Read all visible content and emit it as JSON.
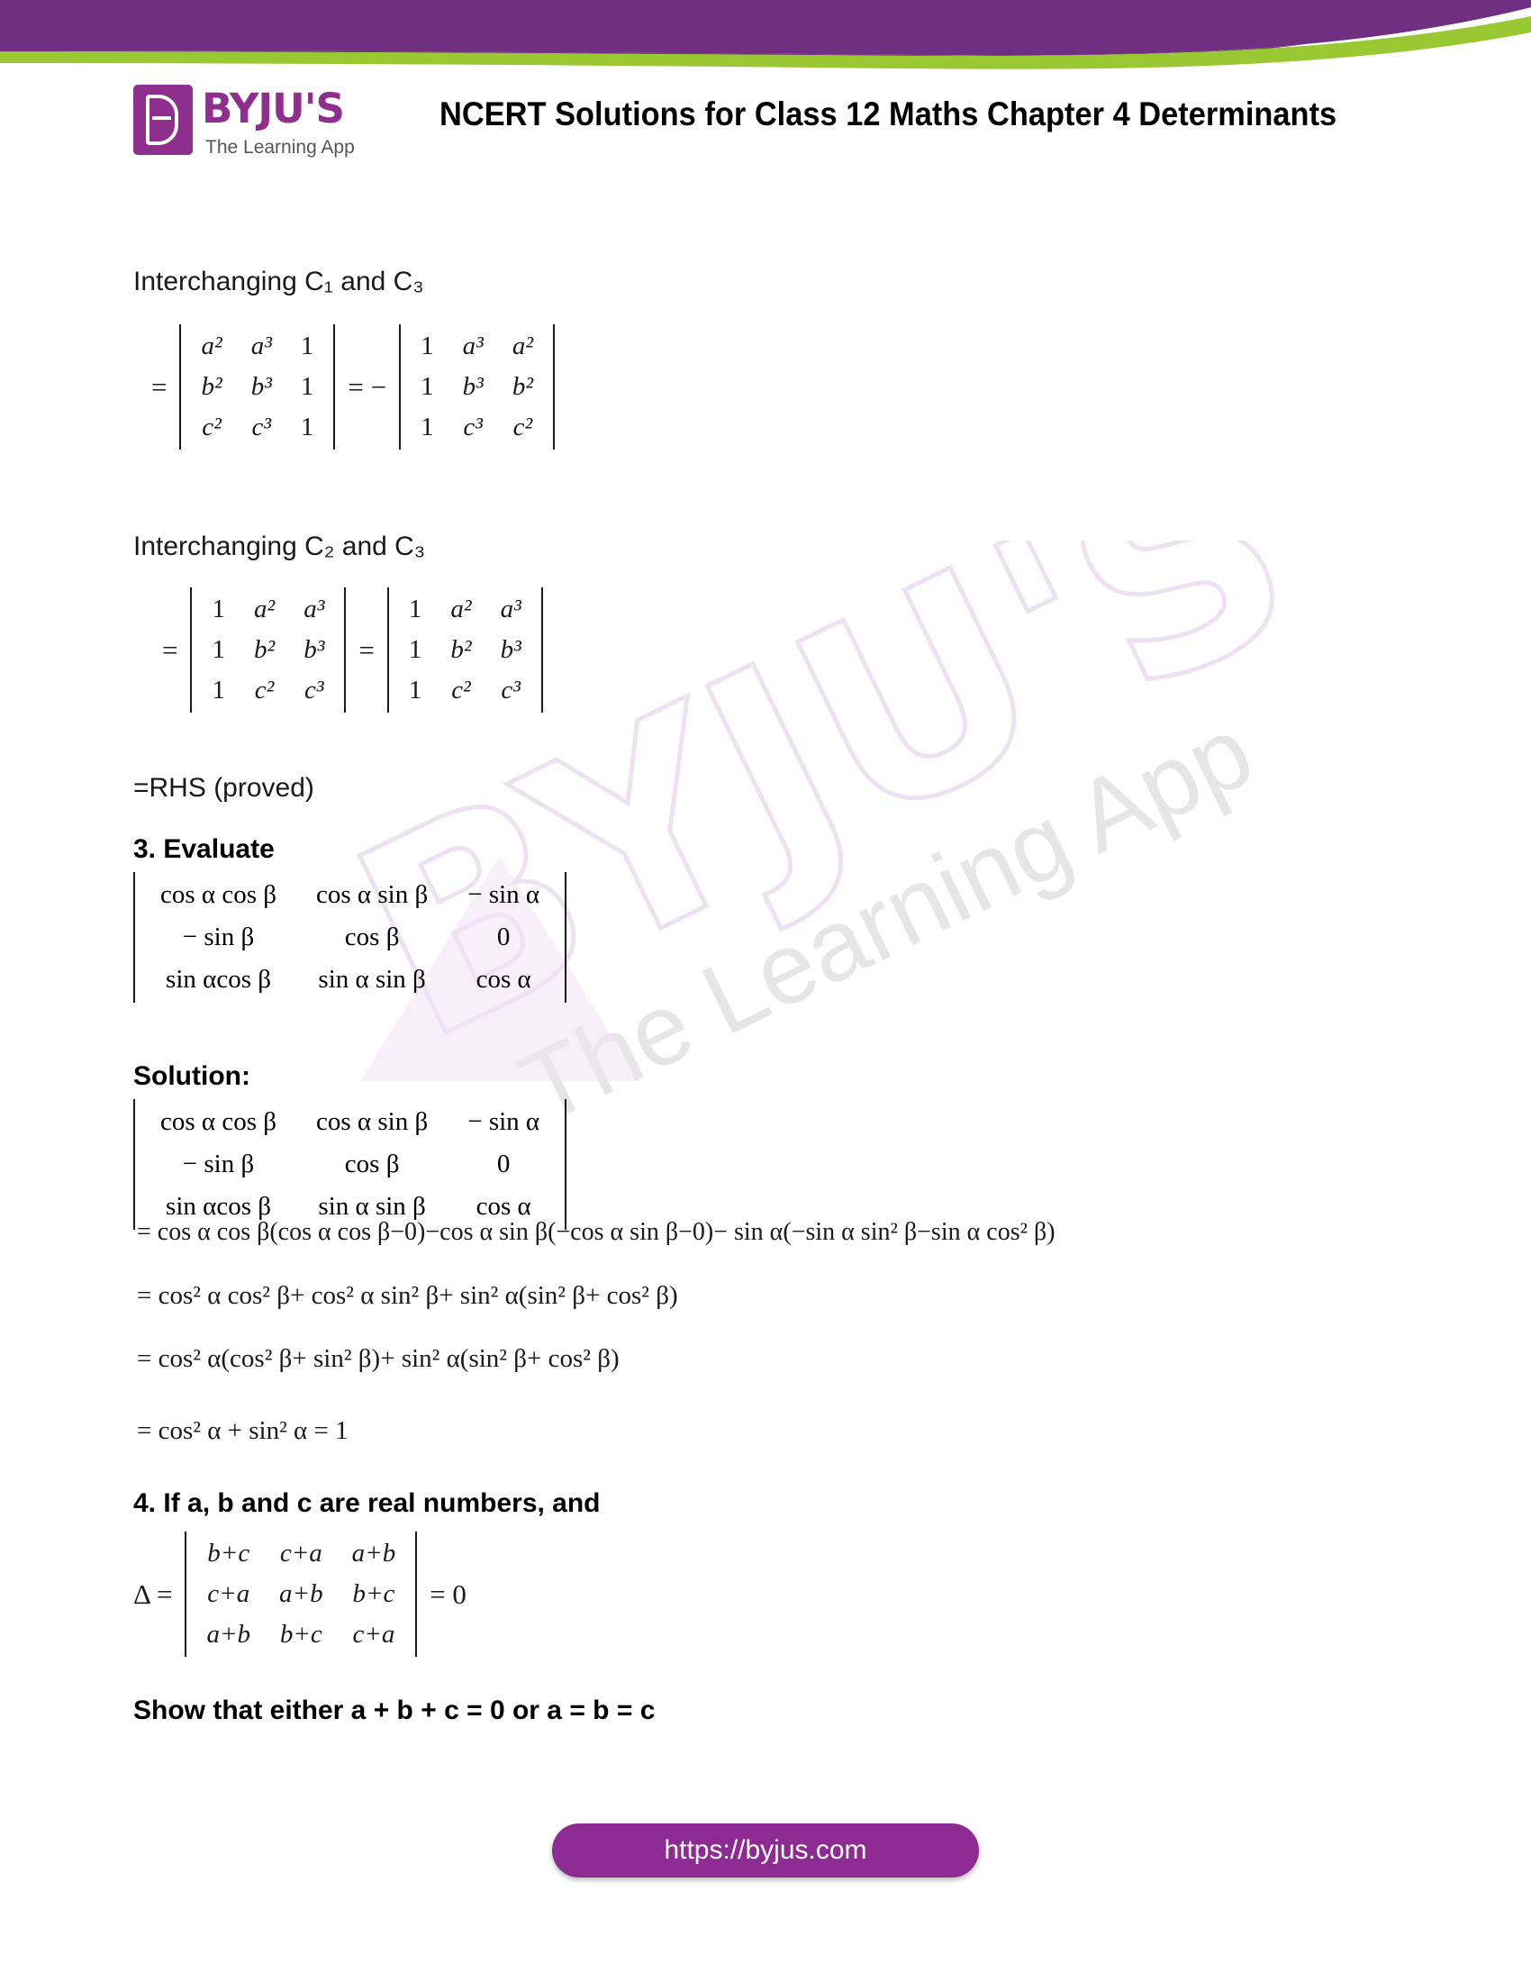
{
  "brand": {
    "logo_word": "BYJU'S",
    "logo_tagline": "The Learning App",
    "logo_icon": "byjus-b-logo",
    "purple": "#8e2f8e",
    "green": "#9ac832",
    "banner_purple": "#702f80"
  },
  "header": {
    "title": "NCERT Solutions for Class 12 Maths Chapter 4 Determinants"
  },
  "watermark": {
    "word": "BYJU'S",
    "tagline": "The Learning App"
  },
  "content": {
    "interchange_c1_c3": "Interchanging C₁ and C₃",
    "eq1": {
      "lead": "=",
      "matrix_a": {
        "rows": [
          [
            "a²",
            "a³",
            "1"
          ],
          [
            "b²",
            "b³",
            "1"
          ],
          [
            "c²",
            "c³",
            "1"
          ]
        ]
      },
      "middle": "= −",
      "matrix_b": {
        "rows": [
          [
            "1",
            "a³",
            "a²"
          ],
          [
            "1",
            "b³",
            "b²"
          ],
          [
            "1",
            "c³",
            "c²"
          ]
        ]
      }
    },
    "interchange_c2_c3": "Interchanging C₂ and C₃",
    "eq2": {
      "lead": "=",
      "matrix_a": {
        "rows": [
          [
            "1",
            "a²",
            "a³"
          ],
          [
            "1",
            "b²",
            "b³"
          ],
          [
            "1",
            "c²",
            "c³"
          ]
        ]
      },
      "middle": "=",
      "matrix_b": {
        "rows": [
          [
            "1",
            "a²",
            "a³"
          ],
          [
            "1",
            "b²",
            "b³"
          ],
          [
            "1",
            "c²",
            "c³"
          ]
        ]
      }
    },
    "rhs_proved": "=RHS (proved)",
    "q3_heading": "3. Evaluate",
    "q3_matrix": {
      "rows": [
        [
          "cos α cos β",
          "cos α sin β",
          "− sin α"
        ],
        [
          "− sin β",
          "cos β",
          "0"
        ],
        [
          "sin αcos β",
          "sin α sin β",
          "cos α"
        ]
      ]
    },
    "solution_heading": "Solution:",
    "solution_matrix": {
      "rows": [
        [
          "cos α cos β",
          "cos α sin β",
          "− sin α"
        ],
        [
          "− sin β",
          "cos β",
          "0"
        ],
        [
          "sin αcos β",
          "sin α sin β",
          "cos α"
        ]
      ]
    },
    "steps": [
      "= cos α cos β(cos α cos β−0)−cos α sin β(−cos α sin β−0)− sin α(−sin α sin² β−sin α cos² β)",
      "=  cos² α cos² β+ cos² α sin² β+ sin² α(sin² β+ cos² β)",
      "=  cos² α(cos² β+ sin² β)+ sin² α(sin² β+ cos² β)",
      "= cos² α + sin² α =  1"
    ],
    "q4_heading": "4. If a, b and c are real numbers, and",
    "q4_delta_label": "Δ =",
    "q4_matrix": {
      "rows": [
        [
          "b+c",
          "c+a",
          "a+b"
        ],
        [
          "c+a",
          "a+b",
          "b+c"
        ],
        [
          "a+b",
          "b+c",
          "c+a"
        ]
      ]
    },
    "q4_equals_zero": "= 0",
    "q4_show_that": "Show that either a + b + c = 0 or a = b = c"
  },
  "footer": {
    "url": "https://byjus.com"
  }
}
